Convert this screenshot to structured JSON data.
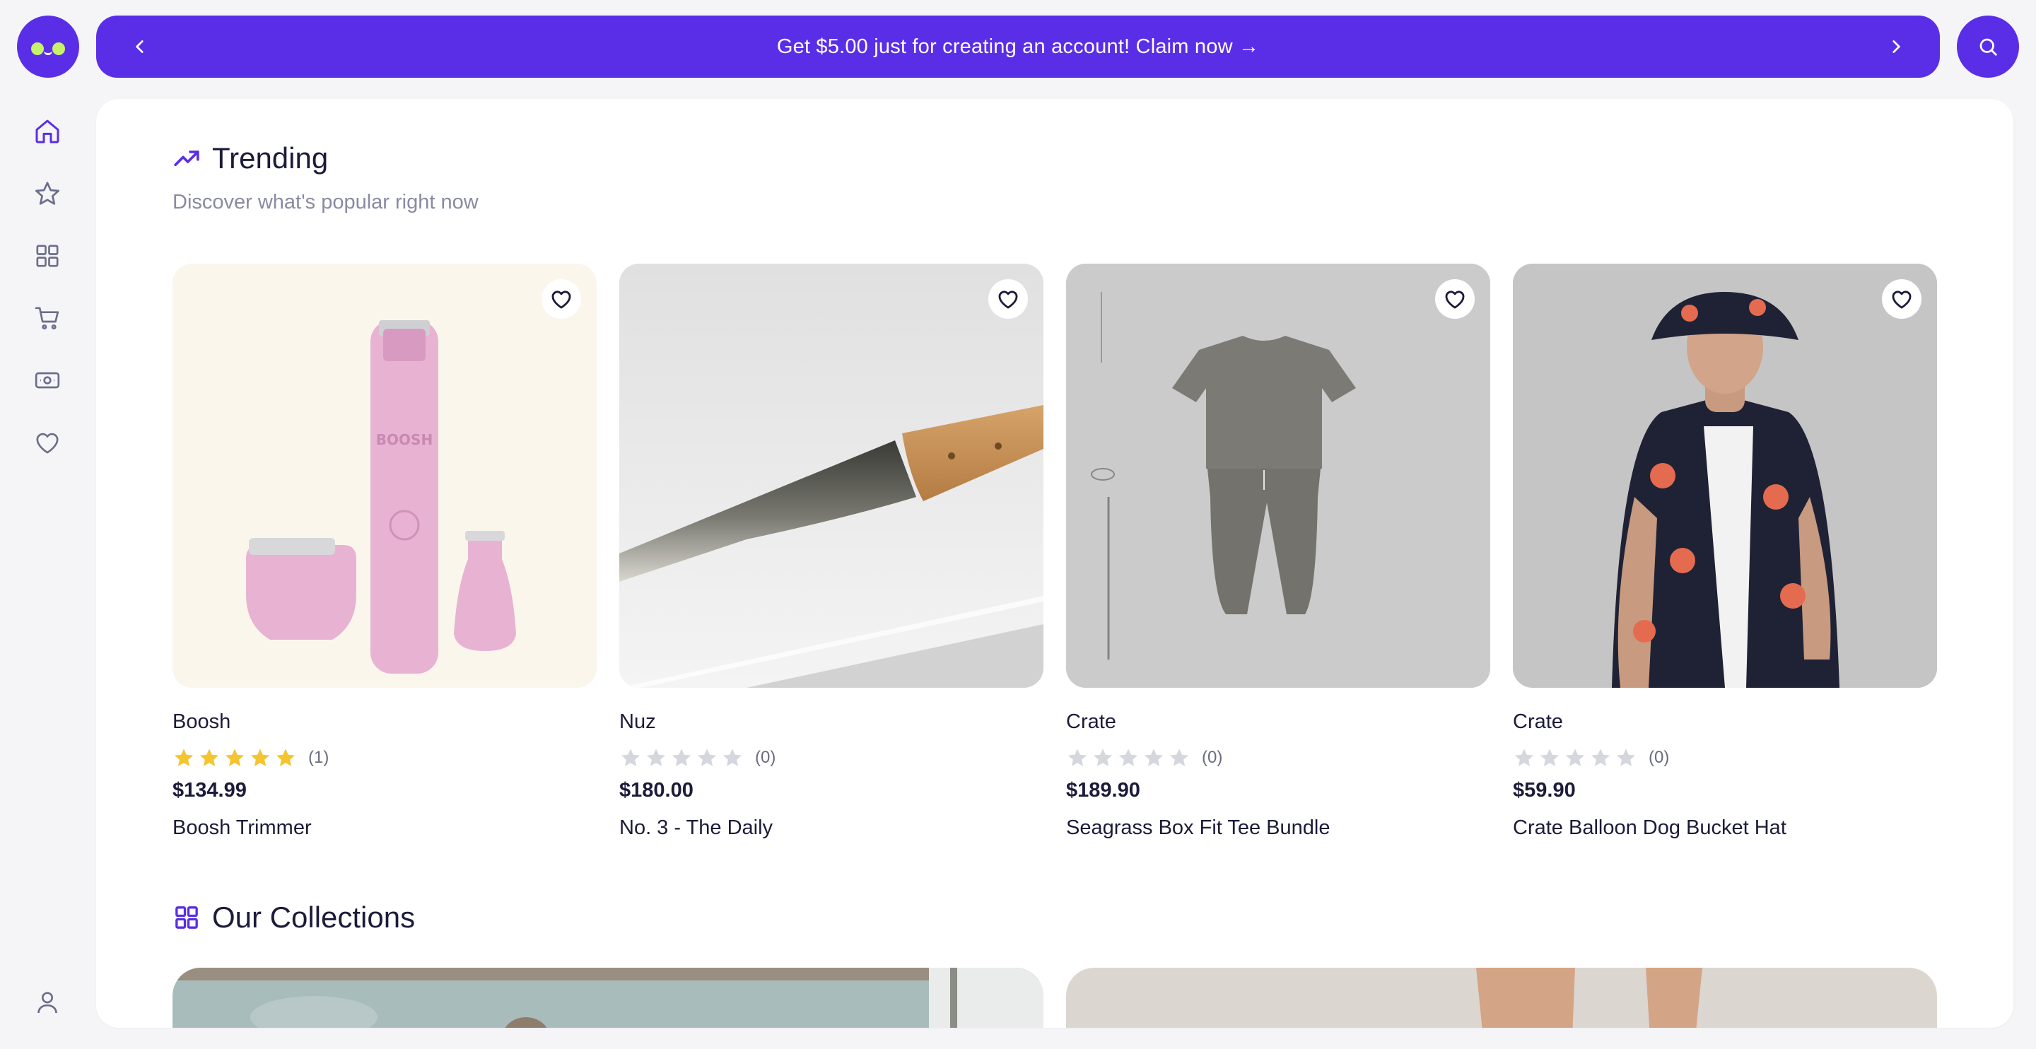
{
  "banner": {
    "text": "Get $5.00 just for creating an account! Claim now →",
    "prev_icon": "chevron-left-icon",
    "next_icon": "chevron-right-icon"
  },
  "search": {
    "icon": "search-icon"
  },
  "sidebar": {
    "items": [
      {
        "name": "home",
        "icon": "home-icon",
        "active": true
      },
      {
        "name": "favorites",
        "icon": "star-icon"
      },
      {
        "name": "categories",
        "icon": "grid-icon"
      },
      {
        "name": "cart",
        "icon": "cart-icon"
      },
      {
        "name": "rewards",
        "icon": "cash-icon"
      },
      {
        "name": "wishlist",
        "icon": "heart-icon"
      }
    ],
    "account_icon": "user-icon"
  },
  "trending": {
    "title": "Trending",
    "subtitle": "Discover what's popular right now",
    "icon": "trending-up-icon",
    "products": [
      {
        "brand": "Boosh",
        "rating": 5,
        "reviews": "(1)",
        "price": "$134.99",
        "name": "Boosh Trimmer"
      },
      {
        "brand": "Nuz",
        "rating": 0,
        "reviews": "(0)",
        "price": "$180.00",
        "name": "No. 3 - The Daily"
      },
      {
        "brand": "Crate",
        "rating": 0,
        "reviews": "(0)",
        "price": "$189.90",
        "name": "Seagrass Box Fit Tee Bundle"
      },
      {
        "brand": "Crate",
        "rating": 0,
        "reviews": "(0)",
        "price": "$59.90",
        "name": "Crate Balloon Dog Bucket Hat"
      }
    ]
  },
  "collections": {
    "title": "Our Collections",
    "icon": "grid-icon"
  },
  "colors": {
    "brand": "#5a2ee6",
    "accent": "#c6f26a",
    "star_filled": "#f5c431",
    "star_empty": "#d5d7de"
  }
}
